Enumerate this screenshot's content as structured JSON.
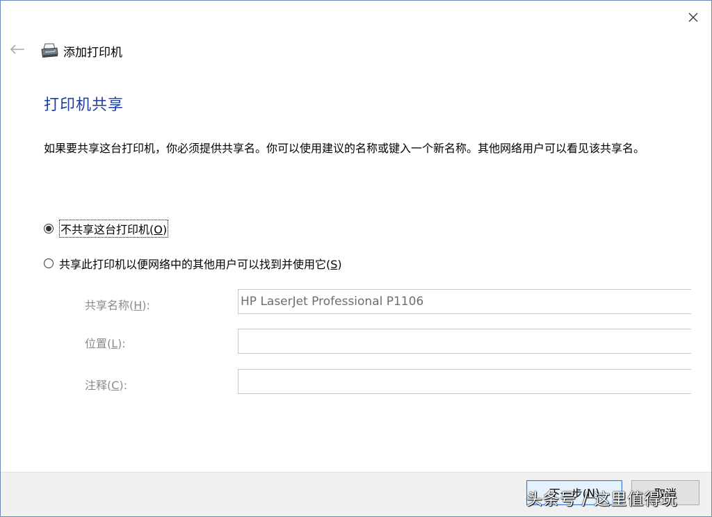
{
  "window": {
    "title": "添加打印机"
  },
  "page": {
    "heading": "打印机共享",
    "description": "如果要共享这台打印机，你必须提供共享名。你可以使用建议的名称或键入一个新名称。其他网络用户可以看见该共享名。"
  },
  "options": [
    {
      "label_pre": "不共享这台打印机(",
      "accel": "O",
      "label_post": ")",
      "selected": true
    },
    {
      "label_pre": "共享此打印机以便网络中的其他用户可以找到并使用它(",
      "accel": "S",
      "label_post": ")",
      "selected": false
    }
  ],
  "fields": {
    "share_name": {
      "label_pre": "共享名称(",
      "accel": "H",
      "label_post": "):",
      "value": "HP LaserJet Professional P1106"
    },
    "location": {
      "label_pre": "位置(",
      "accel": "L",
      "label_post": "):",
      "value": ""
    },
    "comment": {
      "label_pre": "注释(",
      "accel": "C",
      "label_post": "):",
      "value": ""
    }
  },
  "buttons": {
    "next_pre": "下一步(",
    "next_accel": "N",
    "next_post": ")",
    "cancel": "取消"
  },
  "watermark": "头条号 / 这里值得玩",
  "colors": {
    "heading": "#1e3f9e",
    "disabled_text": "#8a8a8a",
    "window_border": "#6b87b6",
    "footer_bg": "#f0f0f0",
    "default_button_border": "#3b78d4"
  },
  "icons": {
    "back": "back-arrow-icon",
    "close": "close-icon",
    "printer": "printer-icon"
  }
}
